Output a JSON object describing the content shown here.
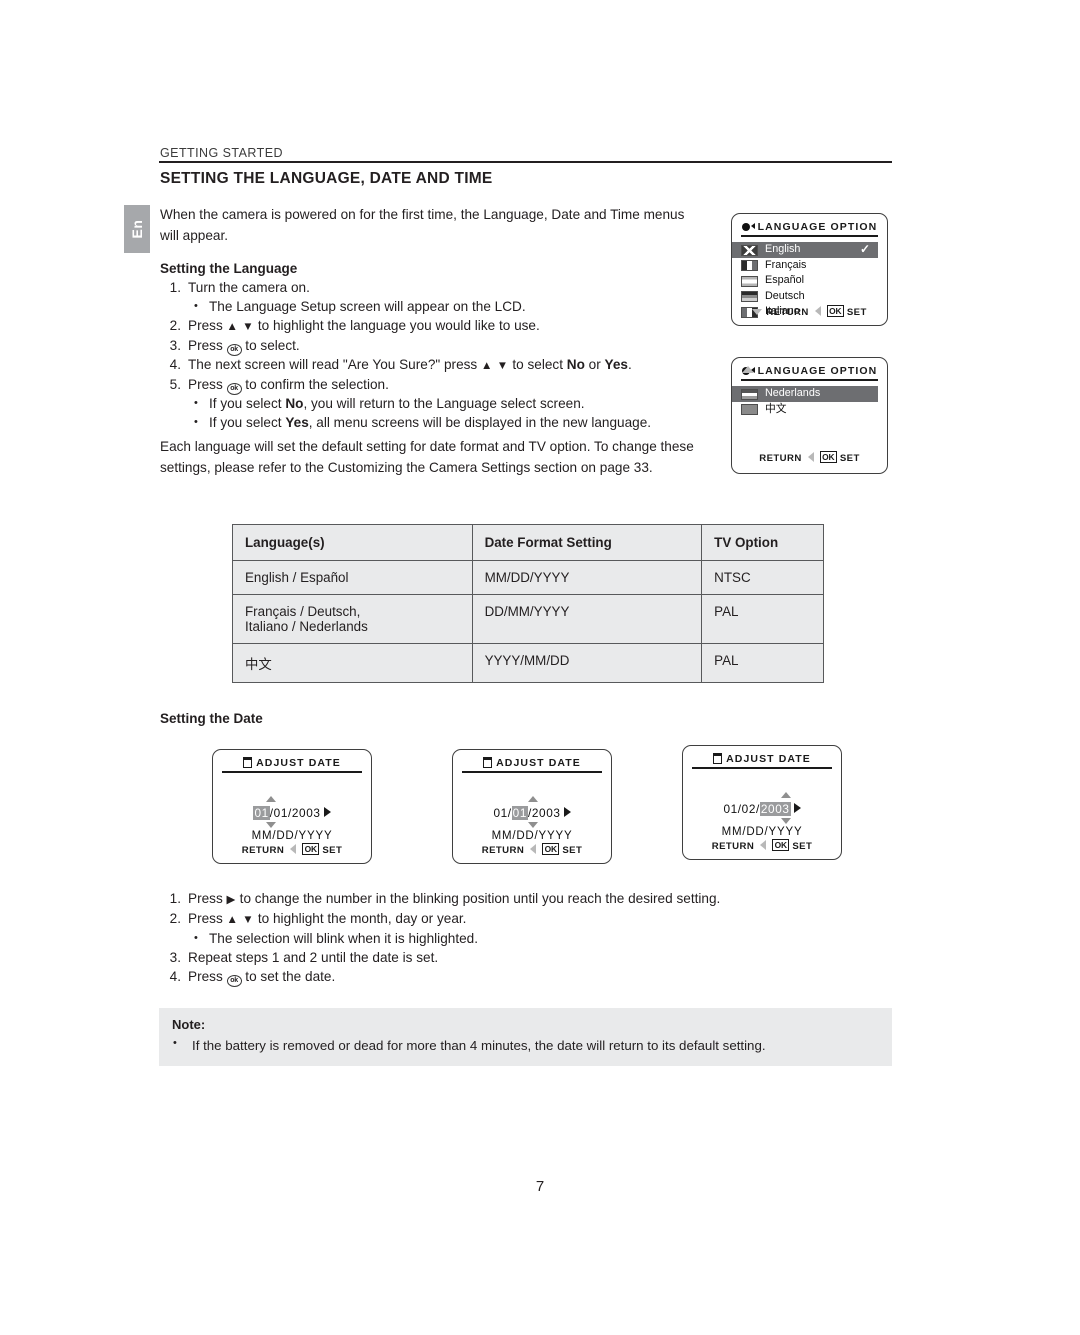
{
  "page": {
    "kicker": "GETTING STARTED",
    "title": "SETTING THE LANGUAGE, DATE AND TIME",
    "side_tab": "En",
    "number": "7"
  },
  "intro": "When the camera is powered on for the first time, the Language, Date and Time menus will appear.",
  "sections": {
    "language_heading": "Setting the Language",
    "date_heading": "Setting the Date"
  },
  "language_steps": [
    {
      "num": "1.",
      "text": "Turn the camera on.",
      "sub": [
        "The Language Setup screen will appear on the LCD."
      ]
    },
    {
      "num": "2.",
      "text": "Press ▲ ▼  to highlight the language you would like to use.",
      "sub": []
    },
    {
      "num": "3.",
      "text": "Press (ok) to select.",
      "sub": []
    },
    {
      "num": "4.",
      "text": "The next screen will read \"Are You Sure?\" press ▲ ▼  to select No or Yes.",
      "sub": []
    },
    {
      "num": "5.",
      "text": "Press (ok) to confirm the selection.",
      "sub": [
        "If you select No, you will return to the Language select screen.",
        "If you select Yes, all menu screens will be displayed in the new language."
      ]
    }
  ],
  "mid_paragraph": "Each language will set the default setting for date format and TV option.  To change these settings, please refer to the Customizing the Camera Settings section on page 33.",
  "table": {
    "headers": [
      "Language(s)",
      "Date Format Setting",
      "TV Option"
    ],
    "rows": [
      {
        "lang": "English / Español",
        "lang2": "",
        "format": "MM/DD/YYYY",
        "tv": "NTSC"
      },
      {
        "lang": "Français / Deutsch,",
        "lang2": "Italiano / Nederlands",
        "format": "DD/MM/YYYY",
        "tv": "PAL"
      },
      {
        "lang": "中文",
        "lang2": "",
        "format": "YYYY/MM/DD",
        "tv": "PAL"
      }
    ]
  },
  "lcd_language_1": {
    "title": "LANGUAGE OPTION",
    "items": [
      {
        "label": "English",
        "flag": "uk-flag-icon",
        "selected": true,
        "check": "✓"
      },
      {
        "label": "Français",
        "flag": "france-flag-icon",
        "selected": false,
        "check": ""
      },
      {
        "label": "Español",
        "flag": "spain-flag-icon",
        "selected": false,
        "check": ""
      },
      {
        "label": "Deutsch",
        "flag": "germany-flag-icon",
        "selected": false,
        "check": ""
      },
      {
        "label": "Italiano",
        "flag": "italy-flag-icon",
        "selected": false,
        "check": ""
      }
    ],
    "footer": {
      "return": "RETURN",
      "ok": "OK",
      "set": "SET"
    }
  },
  "lcd_language_2": {
    "title": "LANGUAGE OPTION",
    "items": [
      {
        "label": "Nederlands",
        "flag": "netherlands-flag-icon",
        "selected": true,
        "check": ""
      },
      {
        "label": "中文",
        "flag": "china-flag-icon",
        "selected": false,
        "check": ""
      }
    ],
    "footer": {
      "return": "RETURN",
      "ok": "OK",
      "set": "SET"
    }
  },
  "lcd_date": [
    {
      "title": "ADJUST DATE",
      "month": "01",
      "day": "01",
      "year": "2003",
      "highlight": "month",
      "format_label": "MM/DD/YYYY",
      "footer": {
        "return": "RETURN",
        "ok": "OK",
        "set": "SET"
      }
    },
    {
      "title": "ADJUST DATE",
      "month": "01",
      "day": "01",
      "year": "2003",
      "highlight": "day",
      "format_label": "MM/DD/YYYY",
      "footer": {
        "return": "RETURN",
        "ok": "OK",
        "set": "SET"
      }
    },
    {
      "title": "ADJUST DATE",
      "month": "01",
      "day": "02",
      "year": "2003",
      "highlight": "year",
      "format_label": "MM/DD/YYYY",
      "footer": {
        "return": "RETURN",
        "ok": "OK",
        "set": "SET"
      }
    }
  ],
  "date_steps": [
    {
      "num": "1.",
      "text": "Press ▶  to change the number in the blinking position until you reach the desired setting.",
      "sub": []
    },
    {
      "num": "2.",
      "text": "Press ▲ ▼ to highlight the month, day or year.",
      "sub": [
        "The selection will blink when it is highlighted."
      ]
    },
    {
      "num": "3.",
      "text": "Repeat steps 1 and 2 until the date is set.",
      "sub": []
    },
    {
      "num": "4.",
      "text": "Press (ok) to set the date.",
      "sub": []
    }
  ],
  "note": {
    "heading": "Note:",
    "body": "If the battery is removed or dead for more than 4 minutes, the date will return to its default setting."
  },
  "colors": {
    "text": "#231f20",
    "panel_gray": "#e9eaeb",
    "tab_gray": "#a6a8ab",
    "select_gray": "#6d6e71",
    "highlight_gray": "#9a9b9d"
  }
}
